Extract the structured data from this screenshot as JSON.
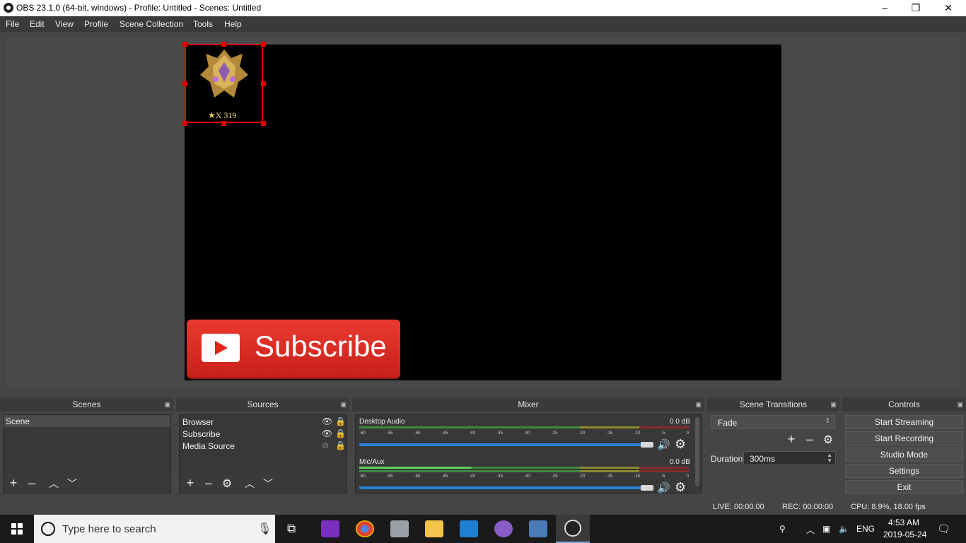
{
  "window": {
    "title": "OBS 23.1.0 (64-bit, windows) - Profile: Untitled - Scenes: Untitled",
    "minimize": "–",
    "maximize": "❐",
    "close": "✕"
  },
  "menu": [
    "File",
    "Edit",
    "View",
    "Profile",
    "Scene Collection",
    "Tools",
    "Help"
  ],
  "preview": {
    "badge_text": "★X 319",
    "subscribe_text": "Subscribe"
  },
  "docks": {
    "scenes": {
      "title": "Scenes",
      "items": [
        "Scene"
      ]
    },
    "sources": {
      "title": "Sources",
      "items": [
        "Browser",
        "Subscribe",
        "Media Source"
      ]
    },
    "mixer": {
      "title": "Mixer",
      "channels": [
        {
          "name": "Desktop Audio",
          "db": "0.0 dB"
        },
        {
          "name": "Mic/Aux",
          "db": "0.0 dB"
        }
      ],
      "scale": [
        "-60",
        "-55",
        "-50",
        "-45",
        "-40",
        "-35",
        "-30",
        "-25",
        "-20",
        "-15",
        "-10",
        "-5",
        "0"
      ]
    },
    "transitions": {
      "title": "Scene Transitions",
      "selected": "Fade",
      "duration_label": "Duration",
      "duration_value": "300ms"
    },
    "controls": {
      "title": "Controls",
      "buttons": [
        "Start Streaming",
        "Start Recording",
        "Studio Mode",
        "Settings",
        "Exit"
      ]
    }
  },
  "status": {
    "live": "LIVE: 00:00:00",
    "rec": "REC: 00:00:00",
    "cpu": "CPU: 8.9%, 18.00 fps"
  },
  "taskbar": {
    "search_placeholder": "Type here to search",
    "lang": "ENG",
    "time": "4:53 AM",
    "date": "2019-05-24"
  },
  "colors": {
    "accent_blue": "#2a82da",
    "selection_red": "#e00000",
    "subscribe_red": "#e2231a"
  }
}
